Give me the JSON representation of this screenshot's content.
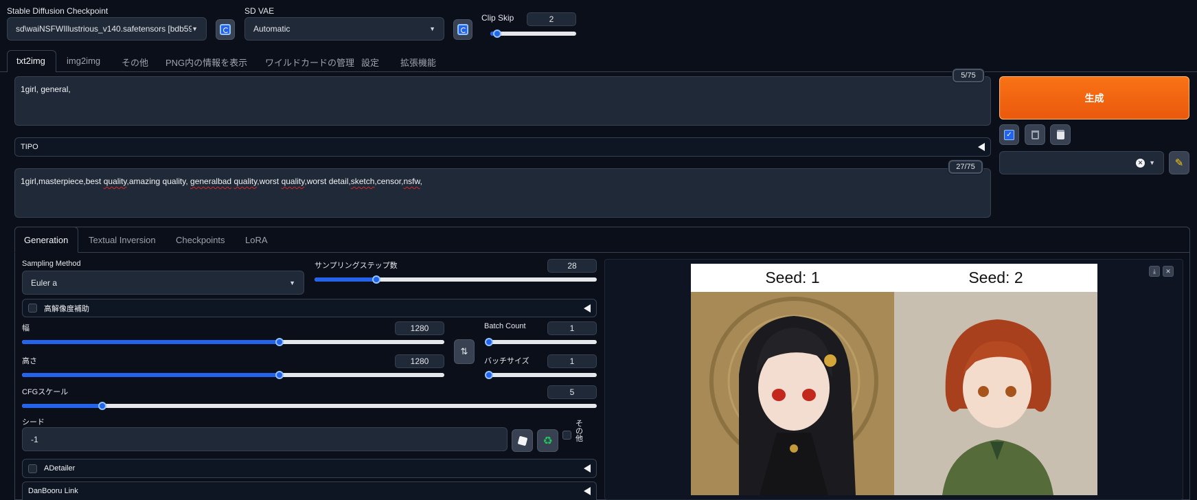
{
  "top": {
    "checkpoint_label": "Stable Diffusion Checkpoint",
    "checkpoint_value": "sd\\waiNSFWIllustrious_v140.safetensors [bdb59",
    "vae_label": "SD VAE",
    "vae_value": "Automatic",
    "clip_skip_label": "Clip Skip",
    "clip_skip_value": "2",
    "clip_skip_fraction": 0.08
  },
  "tabs": [
    "txt2img",
    "img2img",
    "その他",
    "PNG内の情報を表示",
    "ワイルドカードの管理",
    "設定",
    "拡張機能"
  ],
  "prompt": {
    "text": "1girl, general,",
    "counter": "5/75",
    "tipo_label": "TIPO",
    "negative_parts": [
      "1girl,masterpiece,best ",
      "quality",
      ",amazing quality, ",
      "generalbad",
      " ",
      "quality",
      ",worst ",
      "quality",
      ",worst detail,",
      "sketch",
      ",censor,",
      "nsfw",
      ","
    ],
    "negative_counter": "27/75"
  },
  "actions": {
    "generate_label": "生成",
    "styles_value": ""
  },
  "subtabs": [
    "Generation",
    "Textual Inversion",
    "Checkpoints",
    "LoRA"
  ],
  "params": {
    "sampling_method_label": "Sampling Method",
    "sampling_method_value": "Euler a",
    "steps_label": "サンプリングステップ数",
    "steps_value": "28",
    "steps_fraction": 0.22,
    "hires_label": "高解像度補助",
    "width_label": "幅",
    "width_value": "1280",
    "width_fraction": 0.61,
    "height_label": "高さ",
    "height_value": "1280",
    "height_fraction": 0.61,
    "batch_count_label": "Batch Count",
    "batch_count_value": "1",
    "batch_count_fraction": 0.0,
    "batch_size_label": "バッチサイズ",
    "batch_size_value": "1",
    "batch_size_fraction": 0.0,
    "cfg_label": "CFGスケール",
    "cfg_value": "5",
    "cfg_fraction": 0.14,
    "seed_label": "シード",
    "seed_value": "-1",
    "extra_label_1": "そ",
    "extra_label_2": "の",
    "extra_label_3": "他",
    "adetailer_label": "ADetailer",
    "danbooru_label": "DanBooru Link"
  },
  "output": {
    "seed1_label": "Seed: 1",
    "seed2_label": "Seed: 2"
  },
  "colors": {
    "generate_orange": "#ea580c",
    "accent_blue": "#2563eb",
    "background": "#0b0f19"
  }
}
